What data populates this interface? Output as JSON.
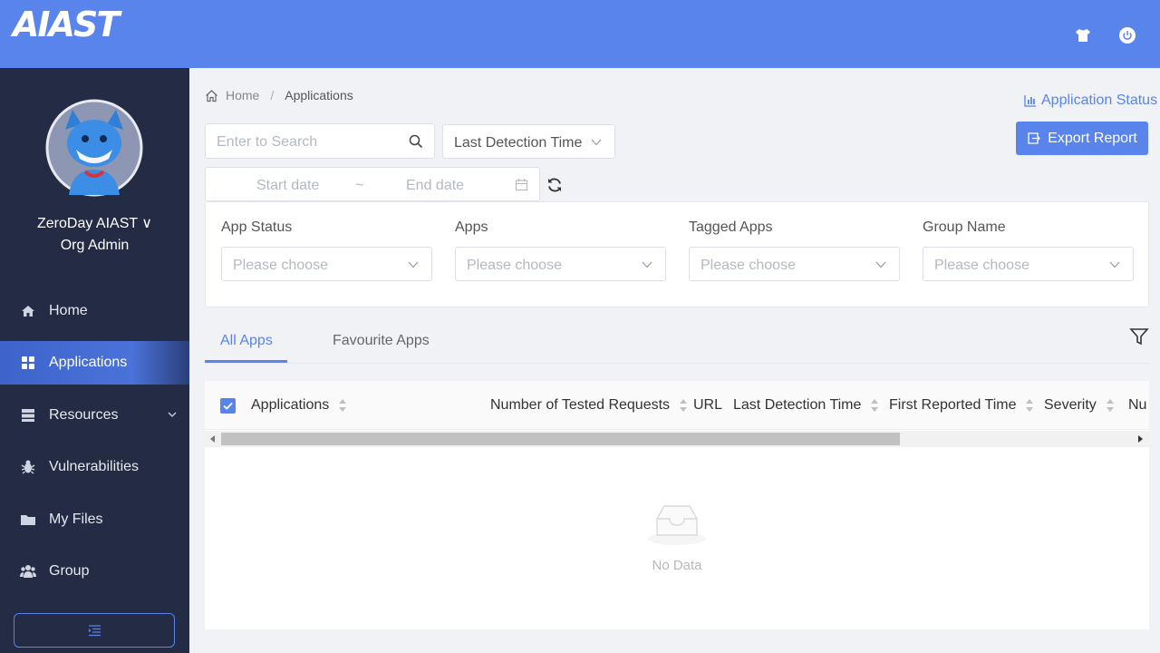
{
  "header": {
    "logo": "AIAST",
    "icons": [
      "shirt-icon",
      "power-icon"
    ]
  },
  "user": {
    "name": "ZeroDay AIAST ∨",
    "role": "Org Admin"
  },
  "sidebar": {
    "items": [
      {
        "label": "Home",
        "icon": "home-icon"
      },
      {
        "label": "Applications",
        "icon": "grid-icon",
        "active": true
      },
      {
        "label": "Resources",
        "icon": "server-icon"
      },
      {
        "label": "Vulnerabilities",
        "icon": "bug-icon"
      },
      {
        "label": "My Files",
        "icon": "folder-icon"
      },
      {
        "label": "Group",
        "icon": "users-icon"
      }
    ]
  },
  "breadcrumb": {
    "home": "Home",
    "separator": "/",
    "current": "Applications"
  },
  "actions": {
    "app_status": "Application Status",
    "export": "Export Report"
  },
  "search": {
    "placeholder": "Enter to Search"
  },
  "sort": {
    "selected": "Last Detection Time"
  },
  "date_range": {
    "start": "Start date",
    "tilde": "~",
    "end": "End date"
  },
  "filters": [
    {
      "label": "App Status",
      "placeholder": "Please choose"
    },
    {
      "label": "Apps",
      "placeholder": "Please choose"
    },
    {
      "label": "Tagged Apps",
      "placeholder": "Please choose"
    },
    {
      "label": "Group Name",
      "placeholder": "Please choose"
    }
  ],
  "tabs": [
    {
      "label": "All Apps",
      "active": true
    },
    {
      "label": "Favourite Apps"
    }
  ],
  "table": {
    "columns": [
      "Applications",
      "Number of Tested Requests",
      "URL",
      "Last Detection Time",
      "First Reported Time",
      "Severity",
      "Nu"
    ],
    "empty_text": "No Data"
  },
  "colors": {
    "accent": "#5884ec",
    "sidebar": "#232b45"
  }
}
